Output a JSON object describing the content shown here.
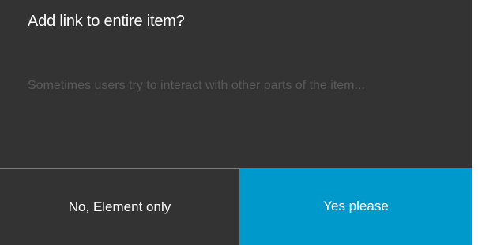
{
  "dialog": {
    "title": "Add link to entire item?",
    "message": "Sometimes users try to interact with other parts of the item...",
    "no_label": "No, Element only",
    "yes_label": "Yes please"
  },
  "colors": {
    "background": "#333333",
    "accent": "#0099cc",
    "text": "#ffffff",
    "muted_text": "#595959"
  }
}
